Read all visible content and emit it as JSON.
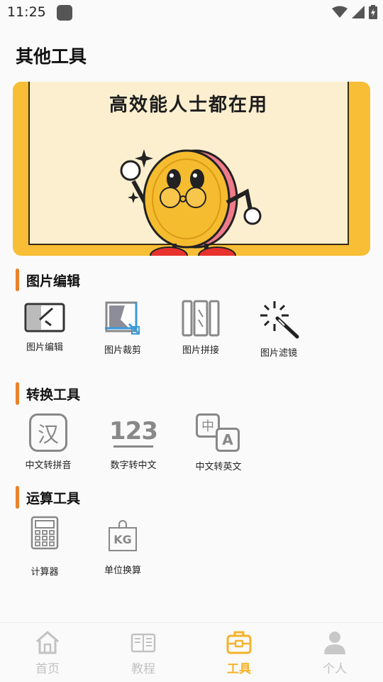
{
  "status": {
    "time": "11:25"
  },
  "page": {
    "title": "其他工具"
  },
  "banner": {
    "text": "高效能人士都在用"
  },
  "sections": [
    {
      "title": "图片编辑",
      "tools": [
        {
          "label": "图片编辑",
          "icon": "image-edit-icon"
        },
        {
          "label": "图片裁剪",
          "icon": "image-crop-icon"
        },
        {
          "label": "图片拼接",
          "icon": "image-stitch-icon"
        },
        {
          "label": "图片滤镜",
          "icon": "magic-wand-icon"
        }
      ]
    },
    {
      "title": "转换工具",
      "tools": [
        {
          "label": "中文转拼音",
          "icon": "han-char-icon",
          "glyph": "汉"
        },
        {
          "label": "数字转中文",
          "icon": "number-123-icon",
          "glyph": "123"
        },
        {
          "label": "中文转英文",
          "icon": "translate-icon",
          "glyph_a": "中",
          "glyph_b": "A"
        }
      ]
    },
    {
      "title": "运算工具",
      "tools": [
        {
          "label": "计算器",
          "icon": "calculator-icon"
        },
        {
          "label": "单位换算",
          "icon": "weight-kg-icon",
          "glyph": "KG"
        }
      ]
    }
  ],
  "tabbar": {
    "tabs": [
      {
        "label": "首页",
        "icon": "home-icon",
        "active": false
      },
      {
        "label": "教程",
        "icon": "book-icon",
        "active": false
      },
      {
        "label": "工具",
        "icon": "toolbox-icon",
        "active": true
      },
      {
        "label": "个人",
        "icon": "person-icon",
        "active": false
      }
    ]
  },
  "colors": {
    "accent": "#f4b32c",
    "section_bar": "#e8832a",
    "inactive": "#c2c2c2",
    "banner_bg": "#f7be36"
  }
}
